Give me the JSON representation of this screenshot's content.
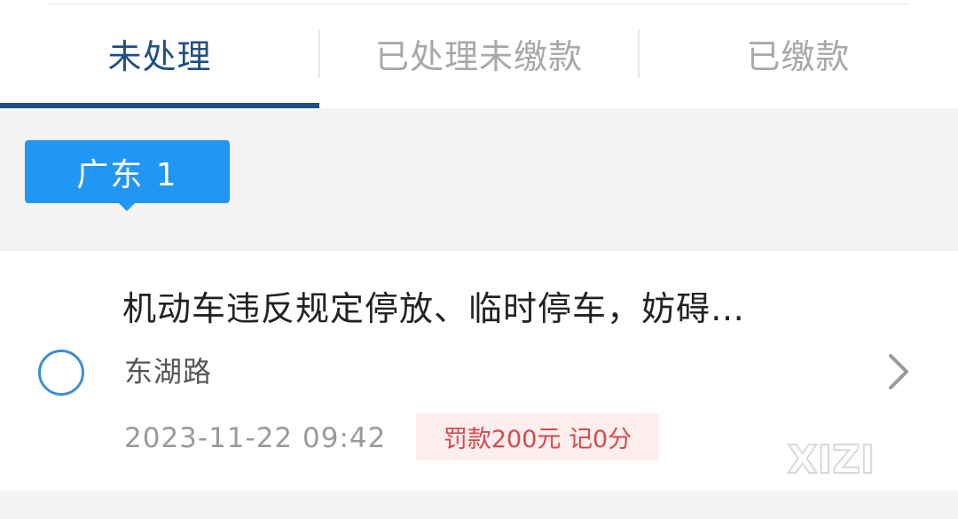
{
  "tabs": [
    {
      "label": "未处理",
      "active": true
    },
    {
      "label": "已处理未缴款",
      "active": false
    },
    {
      "label": "已缴款",
      "active": false
    }
  ],
  "plate": {
    "label": "广东 1"
  },
  "violation": {
    "title": "机动车违反规定停放、临时停车，妨碍…",
    "location": "东湖路",
    "datetime": "2023-11-22 09:42",
    "penalty": "罚款200元 记0分"
  },
  "watermark": {
    "text": "XIZI"
  },
  "colors": {
    "active_tab": "#1f4f86",
    "inactive_tab": "#a8a8a8",
    "plate_badge": "#2196f3",
    "penalty_text": "#d84a4a",
    "penalty_bg": "#fdeeee",
    "radio": "#3a8fd6"
  },
  "icons": {
    "radio": "radio-unchecked-icon",
    "chevron": "chevron-right-icon"
  }
}
